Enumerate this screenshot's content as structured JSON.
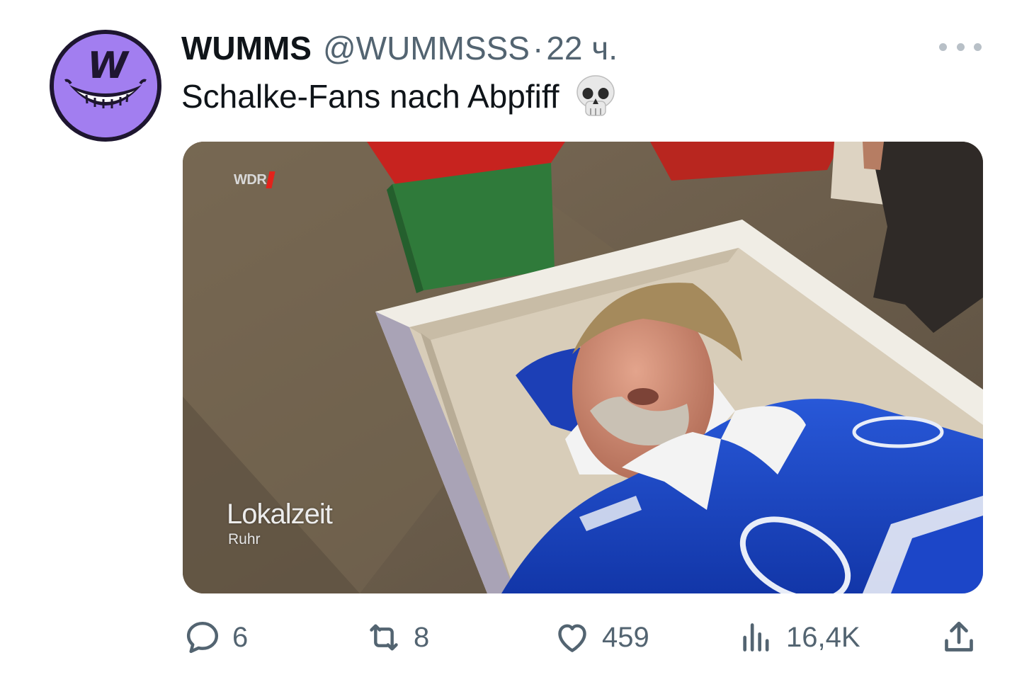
{
  "author": {
    "name": "WUMMS",
    "handle": "@WUMMSSS",
    "separator": "·",
    "time": "22 ч.",
    "avatar_letter": "W",
    "avatar_color": "#a27ef0"
  },
  "tweet": {
    "text": "Schalke-Fans nach Abpfiff",
    "emoji": "skull-emoji"
  },
  "media": {
    "type": "video-still",
    "channel_logo": "WDR",
    "overlay_title": "Lokalzeit",
    "overlay_subtitle": "Ruhr"
  },
  "actions": {
    "replies": {
      "icon": "reply-icon",
      "count": "6"
    },
    "retweets": {
      "icon": "retweet-icon",
      "count": "8"
    },
    "likes": {
      "icon": "heart-icon",
      "count": "459"
    },
    "views": {
      "icon": "views-icon",
      "count": "16,4K"
    },
    "share": {
      "icon": "share-icon"
    }
  },
  "colors": {
    "text_primary": "#0f1419",
    "text_secondary": "#536471",
    "schalke_blue": "#1c46c8"
  }
}
